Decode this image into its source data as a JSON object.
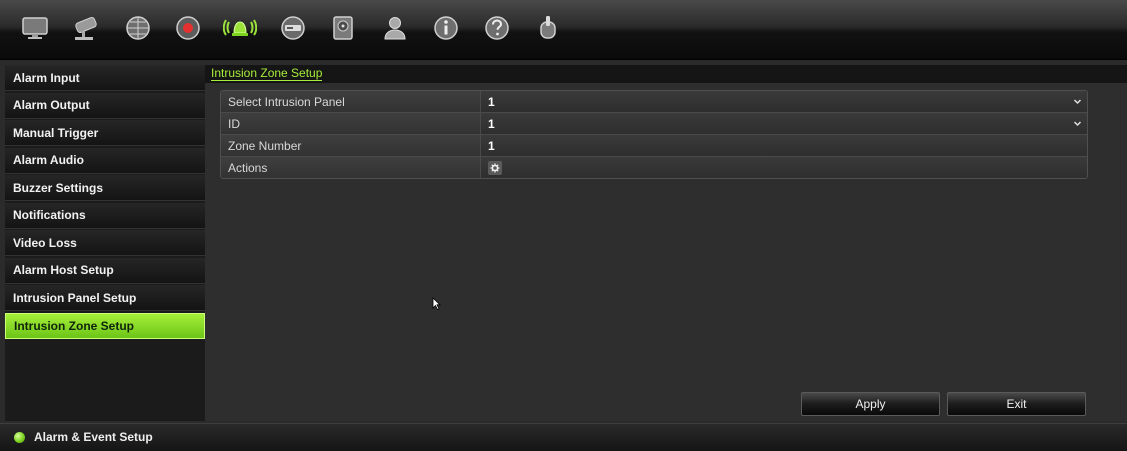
{
  "toolbar": {
    "icons": [
      "display-icon",
      "camera-icon",
      "network-icon",
      "record-icon",
      "alarm-icon",
      "device-icon",
      "storage-icon",
      "user-icon",
      "info-icon",
      "help-icon",
      "power-icon"
    ],
    "active_icon": "alarm-icon"
  },
  "sidebar": {
    "items": [
      {
        "label": "Alarm Input"
      },
      {
        "label": "Alarm Output"
      },
      {
        "label": "Manual Trigger"
      },
      {
        "label": "Alarm Audio"
      },
      {
        "label": "Buzzer Settings"
      },
      {
        "label": "Notifications"
      },
      {
        "label": "Video Loss"
      },
      {
        "label": "Alarm Host Setup"
      },
      {
        "label": "Intrusion Panel Setup"
      },
      {
        "label": "Intrusion Zone Setup"
      }
    ],
    "active_index": 9
  },
  "main": {
    "page_title": "Intrusion Zone Setup",
    "form": {
      "rows": [
        {
          "label": "Select Intrusion Panel",
          "value": "1",
          "control": "dropdown"
        },
        {
          "label": "ID",
          "value": "1",
          "control": "dropdown"
        },
        {
          "label": "Zone Number",
          "value": "1",
          "control": "text"
        },
        {
          "label": "Actions",
          "value": "",
          "control": "gear-button"
        }
      ]
    },
    "buttons": {
      "apply_label": "Apply",
      "exit_label": "Exit"
    }
  },
  "statusbar": {
    "text": "Alarm & Event Setup"
  },
  "colors": {
    "accent": "#8fdf2a",
    "background": "#2e2e2e",
    "sidebar": "#1b1b1b"
  }
}
